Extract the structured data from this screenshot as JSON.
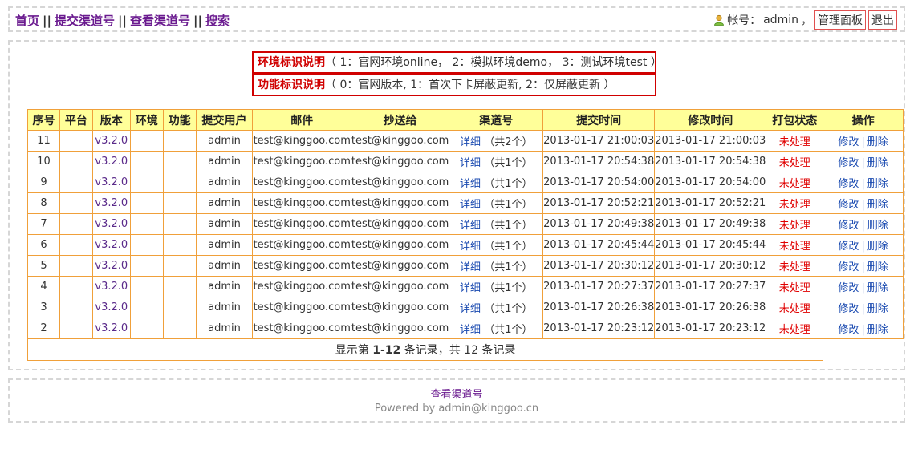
{
  "nav": {
    "home": "首页",
    "submit": "提交渠道号",
    "view": "查看渠道号",
    "search": "搜索",
    "sep": "||"
  },
  "account": {
    "label": "帐号：",
    "username": "admin",
    "comma": "，",
    "admin_panel": "管理面板",
    "logout": "退出",
    "icon": "user-icon"
  },
  "legend": {
    "env_key": "环境标识说明",
    "env_text": "（ 1：官网环境online， 2：模拟环境demo， 3：测试环境test ）",
    "func_key": "功能标识说明",
    "func_text": "（ 0：官网版本, 1：首次下卡屏蔽更新, 2：仅屏蔽更新 ）"
  },
  "table": {
    "headers": [
      "序号",
      "平台",
      "版本",
      "环境",
      "功能",
      "提交用户",
      "邮件",
      "抄送给",
      "渠道号",
      "提交时间",
      "修改时间",
      "打包状态",
      "操作"
    ],
    "rows": [
      {
        "id": "11",
        "platform": "",
        "version": "v3.2.0",
        "env": "",
        "func": "",
        "user": "admin",
        "email": "test@kinggoo.com",
        "cc": "test@kinggoo.com",
        "detail": "详细",
        "count": "（共2个）",
        "submitted": "2013-01-17 21:00:03",
        "modified": "2013-01-17 21:00:03",
        "status": "未处理",
        "edit": "修改",
        "delete": "删除"
      },
      {
        "id": "10",
        "platform": "",
        "version": "v3.2.0",
        "env": "",
        "func": "",
        "user": "admin",
        "email": "test@kinggoo.com",
        "cc": "test@kinggoo.com",
        "detail": "详细",
        "count": "（共1个）",
        "submitted": "2013-01-17 20:54:38",
        "modified": "2013-01-17 20:54:38",
        "status": "未处理",
        "edit": "修改",
        "delete": "删除"
      },
      {
        "id": "9",
        "platform": "",
        "version": "v3.2.0",
        "env": "",
        "func": "",
        "user": "admin",
        "email": "test@kinggoo.com",
        "cc": "test@kinggoo.com",
        "detail": "详细",
        "count": "（共1个）",
        "submitted": "2013-01-17 20:54:00",
        "modified": "2013-01-17 20:54:00",
        "status": "未处理",
        "edit": "修改",
        "delete": "删除"
      },
      {
        "id": "8",
        "platform": "",
        "version": "v3.2.0",
        "env": "",
        "func": "",
        "user": "admin",
        "email": "test@kinggoo.com",
        "cc": "test@kinggoo.com",
        "detail": "详细",
        "count": "（共1个）",
        "submitted": "2013-01-17 20:52:21",
        "modified": "2013-01-17 20:52:21",
        "status": "未处理",
        "edit": "修改",
        "delete": "删除"
      },
      {
        "id": "7",
        "platform": "",
        "version": "v3.2.0",
        "env": "",
        "func": "",
        "user": "admin",
        "email": "test@kinggoo.com",
        "cc": "test@kinggoo.com",
        "detail": "详细",
        "count": "（共1个）",
        "submitted": "2013-01-17 20:49:38",
        "modified": "2013-01-17 20:49:38",
        "status": "未处理",
        "edit": "修改",
        "delete": "删除"
      },
      {
        "id": "6",
        "platform": "",
        "version": "v3.2.0",
        "env": "",
        "func": "",
        "user": "admin",
        "email": "test@kinggoo.com",
        "cc": "test@kinggoo.com",
        "detail": "详细",
        "count": "（共1个）",
        "submitted": "2013-01-17 20:45:44",
        "modified": "2013-01-17 20:45:44",
        "status": "未处理",
        "edit": "修改",
        "delete": "删除"
      },
      {
        "id": "5",
        "platform": "",
        "version": "v3.2.0",
        "env": "",
        "func": "",
        "user": "admin",
        "email": "test@kinggoo.com",
        "cc": "test@kinggoo.com",
        "detail": "详细",
        "count": "（共1个）",
        "submitted": "2013-01-17 20:30:12",
        "modified": "2013-01-17 20:30:12",
        "status": "未处理",
        "edit": "修改",
        "delete": "删除"
      },
      {
        "id": "4",
        "platform": "",
        "version": "v3.2.0",
        "env": "",
        "func": "",
        "user": "admin",
        "email": "test@kinggoo.com",
        "cc": "test@kinggoo.com",
        "detail": "详细",
        "count": "（共1个）",
        "submitted": "2013-01-17 20:27:37",
        "modified": "2013-01-17 20:27:37",
        "status": "未处理",
        "edit": "修改",
        "delete": "删除"
      },
      {
        "id": "3",
        "platform": "",
        "version": "v3.2.0",
        "env": "",
        "func": "",
        "user": "admin",
        "email": "test@kinggoo.com",
        "cc": "test@kinggoo.com",
        "detail": "详细",
        "count": "（共1个）",
        "submitted": "2013-01-17 20:26:38",
        "modified": "2013-01-17 20:26:38",
        "status": "未处理",
        "edit": "修改",
        "delete": "删除"
      },
      {
        "id": "2",
        "platform": "",
        "version": "v3.2.0",
        "env": "",
        "func": "",
        "user": "admin",
        "email": "test@kinggoo.com",
        "cc": "test@kinggoo.com",
        "detail": "详细",
        "count": "（共1个）",
        "submitted": "2013-01-17 20:23:12",
        "modified": "2013-01-17 20:23:12",
        "status": "未处理",
        "edit": "修改",
        "delete": "删除"
      }
    ],
    "summary_prefix": "显示第 ",
    "summary_range": "1-12",
    "summary_mid": " 条记录，共 ",
    "summary_total": "12",
    "summary_suffix": " 条记录",
    "ops_separator": "|"
  },
  "footer": {
    "link": "查看渠道号",
    "powered": "Powered by admin@kinggoo.cn"
  },
  "colors": {
    "link": "#6a1a8f",
    "accent_red": "#d00000",
    "table_border": "#f0a03a",
    "header_bg": "#ffff99"
  }
}
